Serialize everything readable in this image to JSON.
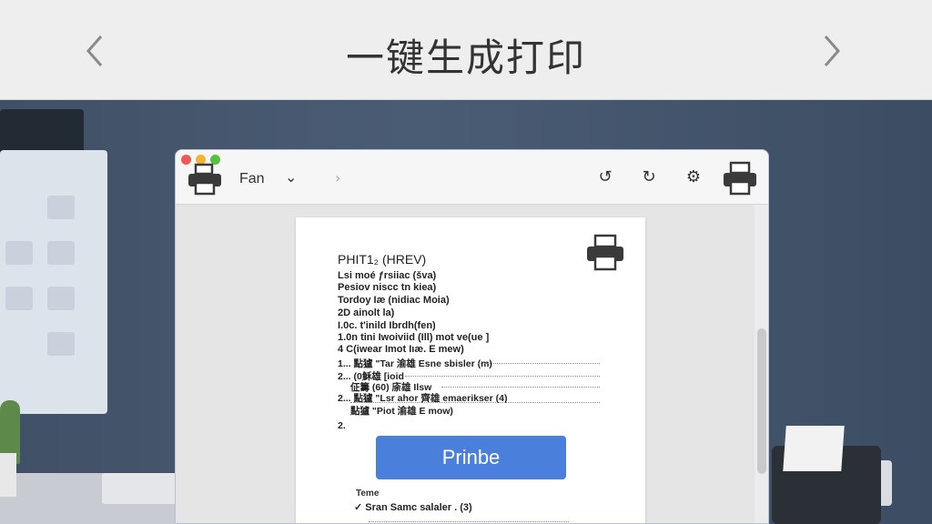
{
  "banner": {
    "title": "一键生成打印",
    "prev_icon": "chevron-left-icon",
    "next_icon": "chevron-right-icon"
  },
  "toolbar": {
    "printer_icon": "printer-icon",
    "label": "Fan",
    "dropdown_icon": "chevron-down-icon",
    "forward_icon": "chevron-right-icon",
    "undo_icon": "undo-icon",
    "redo_icon": "redo-icon",
    "settings_icon": "gear-icon",
    "print_icon": "printer-icon"
  },
  "document": {
    "heading": "PHIT1₂ (HREV)",
    "lines": [
      "Lsi moé ƒrsiiac (šva)",
      "Pesiov niscc tn kiea)",
      "Tordoy Iæ (nidiac Moia)",
      "2D ainolt la)",
      "I.0c. t'inild Ibrdh(fen)",
      "1.0n tini Iwoiviid (Ill) mot ve(ue ]",
      "4 C(iwear Imot Iıæ. E mew)"
    ],
    "items": [
      {
        "num": "1...",
        "text": "點獹 \"Tar 渝雄 Esne sbisler (m)"
      },
      {
        "num": "2...",
        "text": "(0穌雄 [ioid"
      },
      {
        "num": "",
        "text": "佂籌 (60) 庩雄 Ilsw"
      },
      {
        "num": "2...",
        "text": "點獹 \"Lsr ahor 齊雄 emaerikser (4)"
      },
      {
        "num": "",
        "text": "點獹 \"Piot 渝雄 E mow)"
      },
      {
        "num": "2.",
        "text": ""
      }
    ],
    "print_button_label": "Prinbe",
    "footer_label": "Teme",
    "footer_row": "✓ Sran Samc salaler . (3)",
    "doc_printer_icon": "printer-icon"
  }
}
